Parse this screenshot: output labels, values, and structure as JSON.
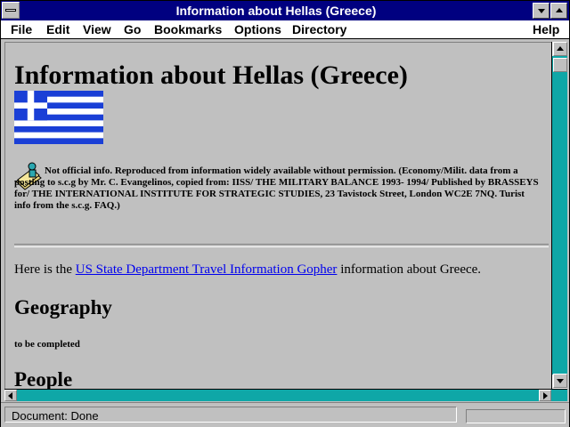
{
  "window": {
    "title": "Information about Hellas (Greece)"
  },
  "menu": {
    "file": "File",
    "edit": "Edit",
    "view": "View",
    "go": "Go",
    "bookmarks": "Bookmarks",
    "options": "Options",
    "directory": "Directory",
    "help": "Help"
  },
  "page": {
    "heading": "Information about Hellas (Greece)",
    "note": "Not official info. Reproduced from information widely available without permission. (Economy/Milit. data from a posting to s.c.g by Mr. C. Evangelinos, copied from: IISS/ THE MILITARY BALANCE 1993- 1994/ Published by BRASSEYS for/ THE INTERNATIONAL INSTITUTE FOR STRATEGIC STUDIES, 23 Tavistock Street, London WC2E 7NQ. Turist info from the s.c.g. FAQ.)",
    "para_before": "Here is the ",
    "link": "US State Department Travel Information Gopher",
    "para_after": " information about Greece.",
    "geography_heading": "Geography",
    "geography_text": "to be completed",
    "people_heading": "People"
  },
  "status": {
    "text": "Document: Done"
  },
  "colors": {
    "titlebar": "#000080",
    "link": "#0000ee",
    "scroll_track": "#0fa7a7",
    "flag_blue": "#1a3fd6"
  }
}
